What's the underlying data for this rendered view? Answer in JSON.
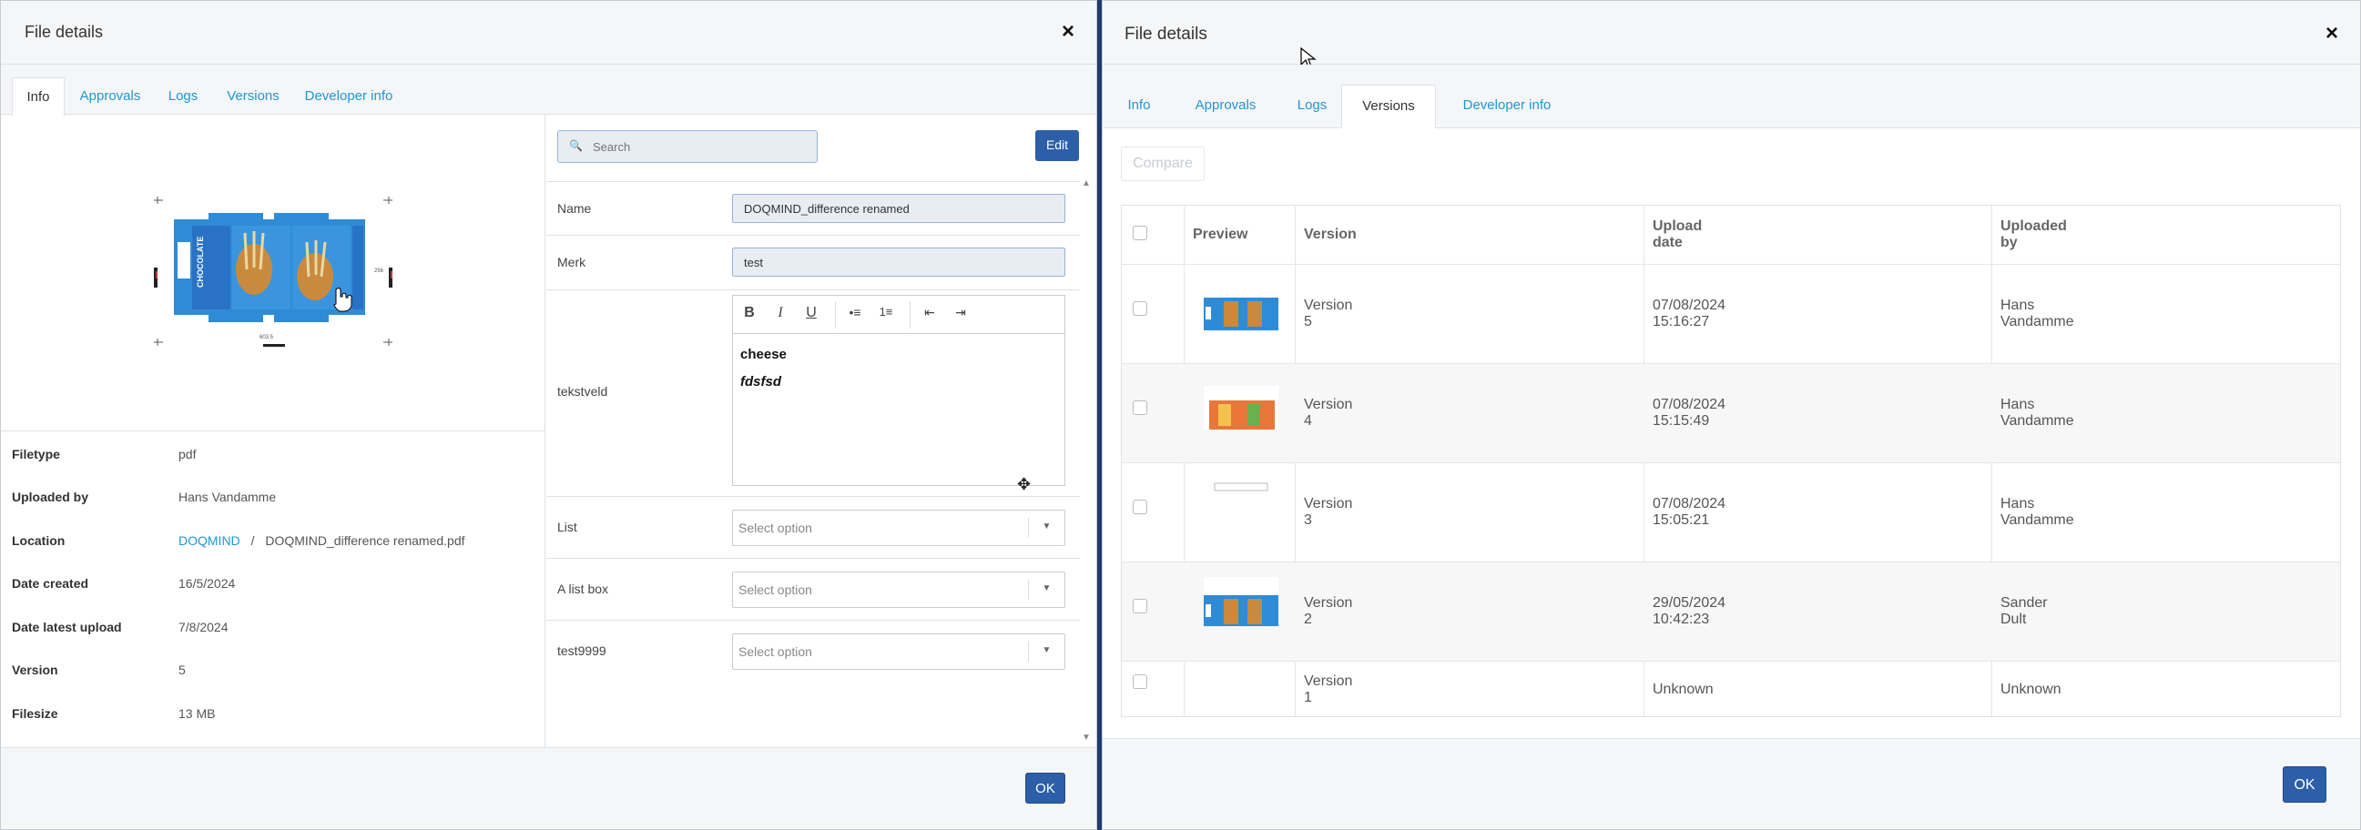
{
  "left_modal": {
    "title": "File details",
    "close": "×",
    "tabs": [
      {
        "label": "Info",
        "active": true
      },
      {
        "label": "Approvals"
      },
      {
        "label": "Logs"
      },
      {
        "label": "Versions"
      },
      {
        "label": "Developer info"
      }
    ],
    "preview_artwork_text": {
      "brand": "CHOCOLATE",
      "dim_width": "603.5",
      "dim_height": "256"
    },
    "metadata": {
      "filetype_label": "Filetype",
      "filetype": "pdf",
      "uploaded_by_label": "Uploaded by",
      "uploaded_by": "Hans Vandamme",
      "location_label": "Location",
      "location_folder": "DOQMIND",
      "location_sep": "/",
      "location_file": "DOQMIND_difference renamed.pdf",
      "date_created_label": "Date created",
      "date_created": "16/5/2024",
      "date_latest_upload_label": "Date latest upload",
      "date_latest_upload": "7/8/2024",
      "version_label": "Version",
      "version": "5",
      "filesize_label": "Filesize",
      "filesize": "13 MB"
    },
    "search_placeholder": "Search",
    "edit_label": "Edit",
    "fields": {
      "name_label": "Name",
      "name_value": "DOQMIND_difference renamed",
      "merk_label": "Merk",
      "merk_value": "test",
      "tekstveld_label": "tekstveld",
      "tekstveld_line1": "cheese",
      "tekstveld_line2": "fdsfsd",
      "list_label": "List",
      "list_value": "Select option",
      "listbox_label": "A list box",
      "listbox_value": "Select option",
      "test9999_label": "test9999",
      "test9999_value": "Select option"
    },
    "toolbar_icons": [
      "bold-icon",
      "italic-icon",
      "underline-icon",
      "bullet-list-icon",
      "numbered-list-icon",
      "outdent-icon",
      "indent-icon"
    ],
    "ok_label": "OK"
  },
  "right_modal": {
    "title": "File details",
    "close": "×",
    "tabs": [
      {
        "label": "Info"
      },
      {
        "label": "Approvals"
      },
      {
        "label": "Logs"
      },
      {
        "label": "Versions",
        "active": true
      },
      {
        "label": "Developer info"
      }
    ],
    "compare_label": "Compare",
    "columns": [
      "Preview",
      "Version",
      "Upload date",
      "Uploaded by"
    ],
    "rows": [
      {
        "version": "Version 5",
        "date": "07/08/2024 15:16:27",
        "by": "Hans Vandamme",
        "thumb": "blue"
      },
      {
        "version": "Version 4",
        "date": "07/08/2024 15:15:49",
        "by": "Hans Vandamme",
        "thumb": "orange"
      },
      {
        "version": "Version 3",
        "date": "07/08/2024 15:05:21",
        "by": "Hans Vandamme",
        "thumb": "blank"
      },
      {
        "version": "Version 2",
        "date": "29/05/2024 10:42:23",
        "by": "Sander Dult",
        "thumb": "blue"
      },
      {
        "version": "Version 1",
        "date": "Unknown",
        "by": "Unknown",
        "thumb": "none"
      }
    ],
    "ok_label": "OK"
  },
  "colors": {
    "accent": "#2d5ea8",
    "link": "#2196d3",
    "backdrop": "#1f3a6b"
  }
}
